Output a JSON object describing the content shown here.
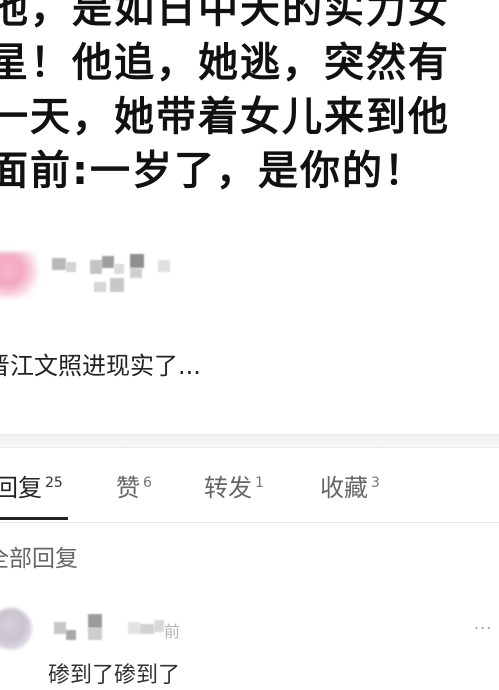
{
  "post": {
    "headline_lines": [
      "他，是如日中天的实力女",
      "星！他追，她逃，突然有",
      "一天，她带着女儿来到他",
      "面前:一岁了，是你的！"
    ],
    "caption": "晋江文照进现实了..."
  },
  "tabs": [
    {
      "label": "回复",
      "count": "25",
      "active": true
    },
    {
      "label": "赞",
      "count": "6",
      "active": false
    },
    {
      "label": "转发",
      "count": "1",
      "active": false
    },
    {
      "label": "收藏",
      "count": "3",
      "active": false
    }
  ],
  "replies_section": {
    "heading": "全部回复"
  },
  "reply": {
    "time": "前",
    "more": "...",
    "text": "碜到了碜到了"
  },
  "colors": {
    "avatar_pink": "#f2a7bf",
    "active_underline": "#222222",
    "inactive_tab": "#666666",
    "divider": "#f2f2f2"
  }
}
